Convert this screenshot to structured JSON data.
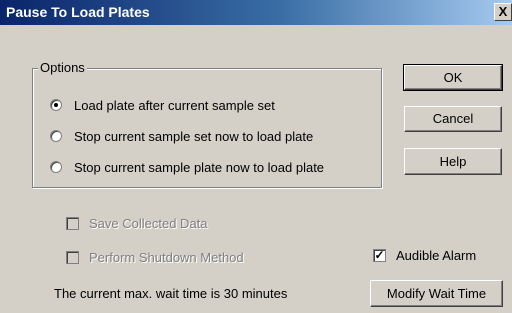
{
  "window": {
    "title": "Pause To Load Plates",
    "close_glyph": "X"
  },
  "options_group": {
    "legend": "Options",
    "radios": [
      {
        "label": "Load plate after current sample set",
        "checked": true
      },
      {
        "label": "Stop current sample set now to load plate",
        "checked": false
      },
      {
        "label": "Stop current sample plate now to load plate",
        "checked": false
      }
    ]
  },
  "buttons": {
    "ok": "OK",
    "cancel": "Cancel",
    "help": "Help",
    "modify_wait": "Modify Wait Time"
  },
  "checkboxes": {
    "save_data": {
      "label": "Save Collected Data",
      "checked": false,
      "enabled": false
    },
    "shutdown": {
      "label": "Perform Shutdown Method",
      "checked": false,
      "enabled": false
    },
    "audible_alarm": {
      "label": "Audible Alarm",
      "checked": true,
      "enabled": true,
      "mark": "✓"
    }
  },
  "status_text": "The current max. wait time is 30 minutes"
}
